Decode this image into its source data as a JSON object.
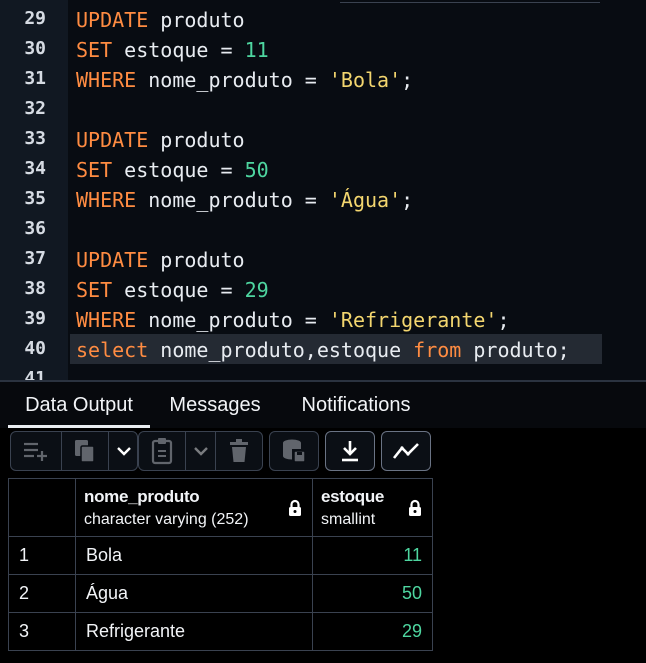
{
  "editor": {
    "lines": [
      {
        "no": "29",
        "tokens": [
          {
            "t": "UPDATE",
            "c": "kw"
          },
          {
            "t": " produto",
            "c": ""
          }
        ]
      },
      {
        "no": "30",
        "tokens": [
          {
            "t": "SET",
            "c": "kw"
          },
          {
            "t": " estoque = ",
            "c": ""
          },
          {
            "t": "11",
            "c": "num"
          }
        ]
      },
      {
        "no": "31",
        "tokens": [
          {
            "t": "WHERE",
            "c": "kw"
          },
          {
            "t": " nome_produto = ",
            "c": ""
          },
          {
            "t": "'Bola'",
            "c": "str"
          },
          {
            "t": ";",
            "c": ""
          }
        ]
      },
      {
        "no": "32",
        "tokens": []
      },
      {
        "no": "33",
        "tokens": [
          {
            "t": "UPDATE",
            "c": "kw"
          },
          {
            "t": " produto",
            "c": ""
          }
        ]
      },
      {
        "no": "34",
        "tokens": [
          {
            "t": "SET",
            "c": "kw"
          },
          {
            "t": " estoque = ",
            "c": ""
          },
          {
            "t": "50",
            "c": "num"
          }
        ]
      },
      {
        "no": "35",
        "tokens": [
          {
            "t": "WHERE",
            "c": "kw"
          },
          {
            "t": " nome_produto = ",
            "c": ""
          },
          {
            "t": "'Água'",
            "c": "str"
          },
          {
            "t": ";",
            "c": ""
          }
        ]
      },
      {
        "no": "36",
        "tokens": []
      },
      {
        "no": "37",
        "tokens": [
          {
            "t": "UPDATE",
            "c": "kw"
          },
          {
            "t": " produto",
            "c": ""
          }
        ]
      },
      {
        "no": "38",
        "tokens": [
          {
            "t": "SET",
            "c": "kw"
          },
          {
            "t": " estoque = ",
            "c": ""
          },
          {
            "t": "29",
            "c": "num"
          }
        ]
      },
      {
        "no": "39",
        "tokens": [
          {
            "t": "WHERE",
            "c": "kw"
          },
          {
            "t": " nome_produto = ",
            "c": ""
          },
          {
            "t": "'Refrigerante'",
            "c": "str"
          },
          {
            "t": ";",
            "c": ""
          }
        ]
      },
      {
        "no": "40",
        "active": true,
        "tokens": [
          {
            "t": "select",
            "c": "kw"
          },
          {
            "t": " nome_produto,estoque ",
            "c": ""
          },
          {
            "t": "from",
            "c": "kw"
          },
          {
            "t": " produto;",
            "c": ""
          }
        ]
      },
      {
        "no": "41",
        "tokens": []
      }
    ]
  },
  "tabs": {
    "data_output": "Data Output",
    "messages": "Messages",
    "notifications": "Notifications"
  },
  "toolbar": {
    "icons": [
      "add-row-icon",
      "copy-icon",
      "chevron-down-icon",
      "paste-icon",
      "chevron-down-icon",
      "delete-icon",
      "save-data-icon",
      "download-icon",
      "graph-icon"
    ]
  },
  "grid": {
    "columns": [
      {
        "name": "nome_produto",
        "type": "character varying (252)"
      },
      {
        "name": "estoque",
        "type": "smallint"
      }
    ],
    "rows": [
      {
        "n": "1",
        "nome_produto": "Bola",
        "estoque": "11"
      },
      {
        "n": "2",
        "nome_produto": "Água",
        "estoque": "50"
      },
      {
        "n": "3",
        "nome_produto": "Refrigerante",
        "estoque": "29"
      }
    ]
  },
  "colors": {
    "keyword": "#ff8c42",
    "number": "#4ed6a0",
    "string": "#f3d66f",
    "background": "#080c12"
  }
}
